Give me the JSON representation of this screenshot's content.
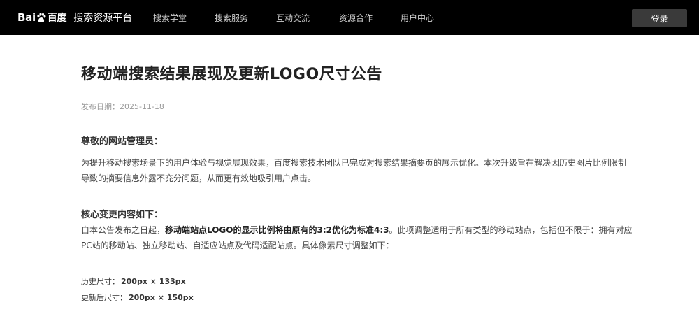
{
  "header": {
    "logo_latin": "Bai",
    "logo_du": "du",
    "logo_cn": "百度",
    "platform": "搜索资源平台",
    "nav": [
      "搜索学堂",
      "搜索服务",
      "互动交流",
      "资源合作",
      "用户中心"
    ],
    "login_label": "登录"
  },
  "article": {
    "title": "移动端搜索结果展现及更新LOGO尺寸公告",
    "date_label": "发布日期：",
    "date": "2025-11-18",
    "greeting": "尊敬的网站管理员：",
    "para1": "为提升移动搜索场景下的用户体验与视觉展现效果，百度搜索技术团队已完成对搜索结果摘要页的展示优化。本次升级旨在解决因历史图片比例限制导致的摘要信息外露不充分问题，从而更有效地吸引用户点击。",
    "section_title": "核心变更内容如下：",
    "para2_pre": "自本公告发布之日起，",
    "para2_bold": "移动端站点LOGO的显示比例将由原有的3:2优化为标准4:3",
    "para2_post": "。此项调整适用于所有类型的移动站点，包括但不限于：拥有对应PC站的移动站、独立移动站、自适应站点及代码适配站点。具体像素尺寸调整如下：",
    "size_old_label": "历史尺寸：",
    "size_old": "200px × 133px",
    "size_new_label": "更新后尺寸：",
    "size_new": "200px × 150px"
  }
}
